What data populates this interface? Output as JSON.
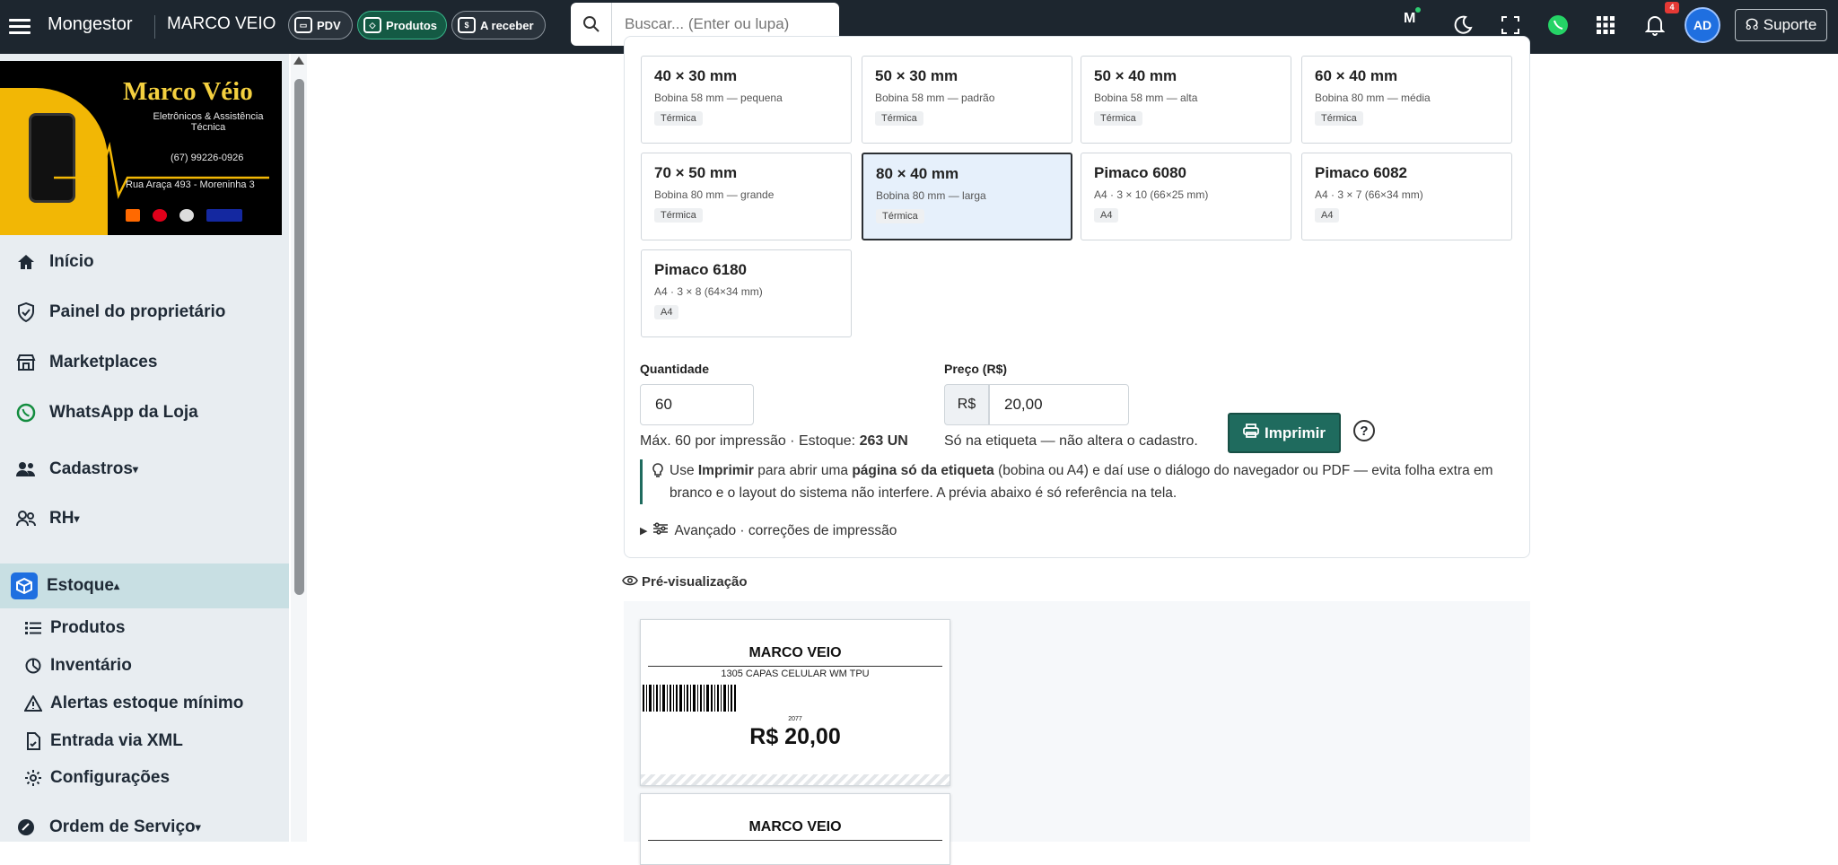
{
  "topbar": {
    "brand": "Mongestor",
    "store": "MARCO VEIO",
    "pills": [
      {
        "label": "PDV"
      },
      {
        "label": "Produtos"
      },
      {
        "label": "A receber"
      }
    ],
    "search_placeholder": "Buscar... (Enter ou lupa)",
    "m_badge": "M",
    "notification_count": "4",
    "avatar": "AD",
    "support": "Suporte"
  },
  "sidebar": {
    "logo": {
      "title": "Marco Véio",
      "subtitle": "Eletrônicos & Assistência Técnica",
      "phone": "(67) 99226-0926",
      "address": "Rua Araça 493 - Moreninha 3"
    },
    "items": [
      {
        "label": "Início",
        "icon": "home-icon"
      },
      {
        "label": "Painel do proprietário",
        "icon": "shield-icon"
      },
      {
        "label": "Marketplaces",
        "icon": "store-icon"
      },
      {
        "label": "WhatsApp da Loja",
        "icon": "whatsapp-icon"
      },
      {
        "label": "Cadastros",
        "icon": "users-icon"
      },
      {
        "label": "RH",
        "icon": "people-icon"
      },
      {
        "label": "Estoque",
        "icon": "box-icon"
      }
    ],
    "subitems": [
      {
        "label": "Produtos",
        "icon": "list-icon"
      },
      {
        "label": "Inventário",
        "icon": "clock-chart-icon"
      },
      {
        "label": "Alertas estoque mínimo",
        "icon": "warning-icon"
      },
      {
        "label": "Entrada via XML",
        "icon": "file-icon"
      },
      {
        "label": "Configurações",
        "icon": "gear-icon"
      }
    ],
    "bottom_item": {
      "label": "Ordem de Serviço",
      "icon": "tools-icon"
    }
  },
  "formats": [
    {
      "name": "40 × 30 mm",
      "desc": "Bobina 58 mm — pequena",
      "tag": "Térmica"
    },
    {
      "name": "50 × 30 mm",
      "desc": "Bobina 58 mm — padrão",
      "tag": "Térmica"
    },
    {
      "name": "50 × 40 mm",
      "desc": "Bobina 58 mm — alta",
      "tag": "Térmica"
    },
    {
      "name": "60 × 40 mm",
      "desc": "Bobina 80 mm — média",
      "tag": "Térmica"
    },
    {
      "name": "70 × 50 mm",
      "desc": "Bobina 80 mm — grande",
      "tag": "Térmica"
    },
    {
      "name": "80 × 40 mm",
      "desc": "Bobina 80 mm — larga",
      "tag": "Térmica"
    },
    {
      "name": "Pimaco 6080",
      "desc": "A4 · 3 × 10 (66×25 mm)",
      "tag": "A4"
    },
    {
      "name": "Pimaco 6082",
      "desc": "A4 · 3 × 7 (66×34 mm)",
      "tag": "A4"
    },
    {
      "name": "Pimaco 6180",
      "desc": "A4 · 3 × 8 (64×34 mm)",
      "tag": "A4"
    }
  ],
  "selected_format": "80 × 40 mm",
  "form": {
    "qty_label": "Quantidade",
    "qty_value": "60",
    "qty_hint_prefix": "Máx. 60 por impressão · Estoque: ",
    "qty_hint_stock": "263 UN",
    "price_label": "Preço (R$)",
    "currency": "R$",
    "price_value": "20,00",
    "price_hint": "Só na etiqueta — não altera o cadastro.",
    "print_button": "Imprimir",
    "help": "?"
  },
  "note": {
    "p1": "Use ",
    "b1": "Imprimir",
    "p2": " para abrir uma ",
    "b2": "página só da etiqueta",
    "p3": " (bobina ou A4) e daí use o diálogo do navegador ou PDF — evita folha extra em branco e o layout do sistema não interfere. A prévia abaixo é só referência na tela."
  },
  "advanced": "Avançado · correções de impressão",
  "preview": {
    "title": "Pré-visualização",
    "store": "MARCO VEIO",
    "product": "1305 CAPAS CELULAR WM TPU",
    "code": "2077",
    "price": "R$ 20,00"
  }
}
